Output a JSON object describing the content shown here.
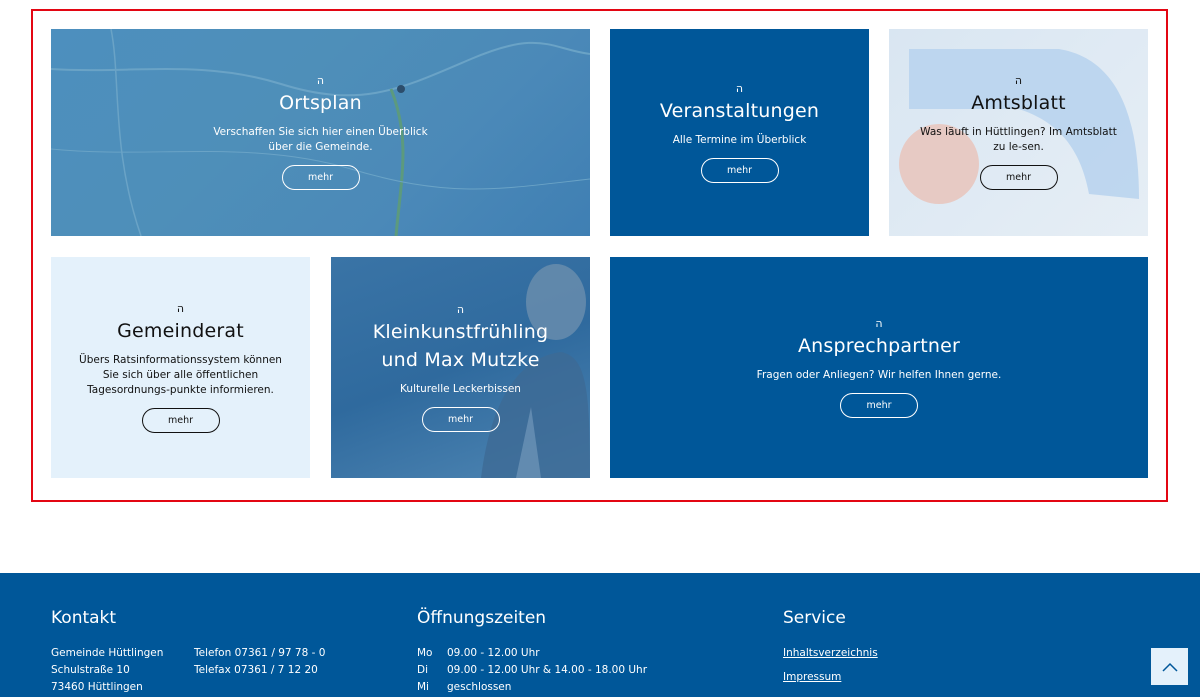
{
  "tiles": {
    "ortsplan": {
      "glyph": "ה",
      "title": "Ortsplan",
      "text": "Verschaffen Sie sich hier einen Überblick über die Gemeinde.",
      "button": "mehr"
    },
    "veranstaltungen": {
      "glyph": "ה",
      "title": "Veranstaltungen",
      "text": "Alle Termine im Überblick",
      "button": "mehr"
    },
    "amtsblatt": {
      "glyph": "ה",
      "title": "Amtsblatt",
      "text": "Was läuft in Hüttlingen? Im Amtsblatt zu le-sen.",
      "button": "mehr"
    },
    "gemeinderat": {
      "glyph": "ה",
      "title": "Gemeinderat",
      "text": "Übers Ratsinformationssystem können Sie sich über alle öffentlichen Tagesordnungs-punkte informieren.",
      "button": "mehr"
    },
    "kleinkunst": {
      "glyph": "ה",
      "title": "Kleinkunstfrühling und Max Mutzke",
      "text": "Kulturelle Leckerbissen",
      "button": "mehr"
    },
    "ansprechpartner": {
      "glyph": "ה",
      "title": "Ansprechpartner",
      "text": "Fragen oder Anliegen? Wir helfen Ihnen gerne.",
      "button": "mehr"
    }
  },
  "footer": {
    "kontakt": {
      "heading": "Kontakt",
      "address": [
        "Gemeinde Hüttlingen",
        "Schulstraße 10",
        "73460 Hüttlingen"
      ],
      "phone": "Telefon 07361 / 97 78 - 0",
      "fax": "Telefax 07361 / 7 12 20"
    },
    "oeffnungszeiten": {
      "heading": "Öffnungszeiten",
      "rows": [
        {
          "day": "Mo",
          "hours": "09.00 - 12.00 Uhr"
        },
        {
          "day": "Di",
          "hours": "09.00 - 12.00 Uhr & 14.00 - 18.00 Uhr"
        },
        {
          "day": "Mi",
          "hours": "geschlossen"
        }
      ]
    },
    "service": {
      "heading": "Service",
      "links": [
        "Inhaltsverzeichnis",
        "Impressum"
      ]
    }
  },
  "colors": {
    "brand_blue": "#005799",
    "light_blue": "#e4f1fb",
    "highlight_border": "#e30613"
  },
  "icons": {
    "scroll_top": "chevron-up-icon",
    "tile_glyph": "tile-symbol-icon"
  }
}
